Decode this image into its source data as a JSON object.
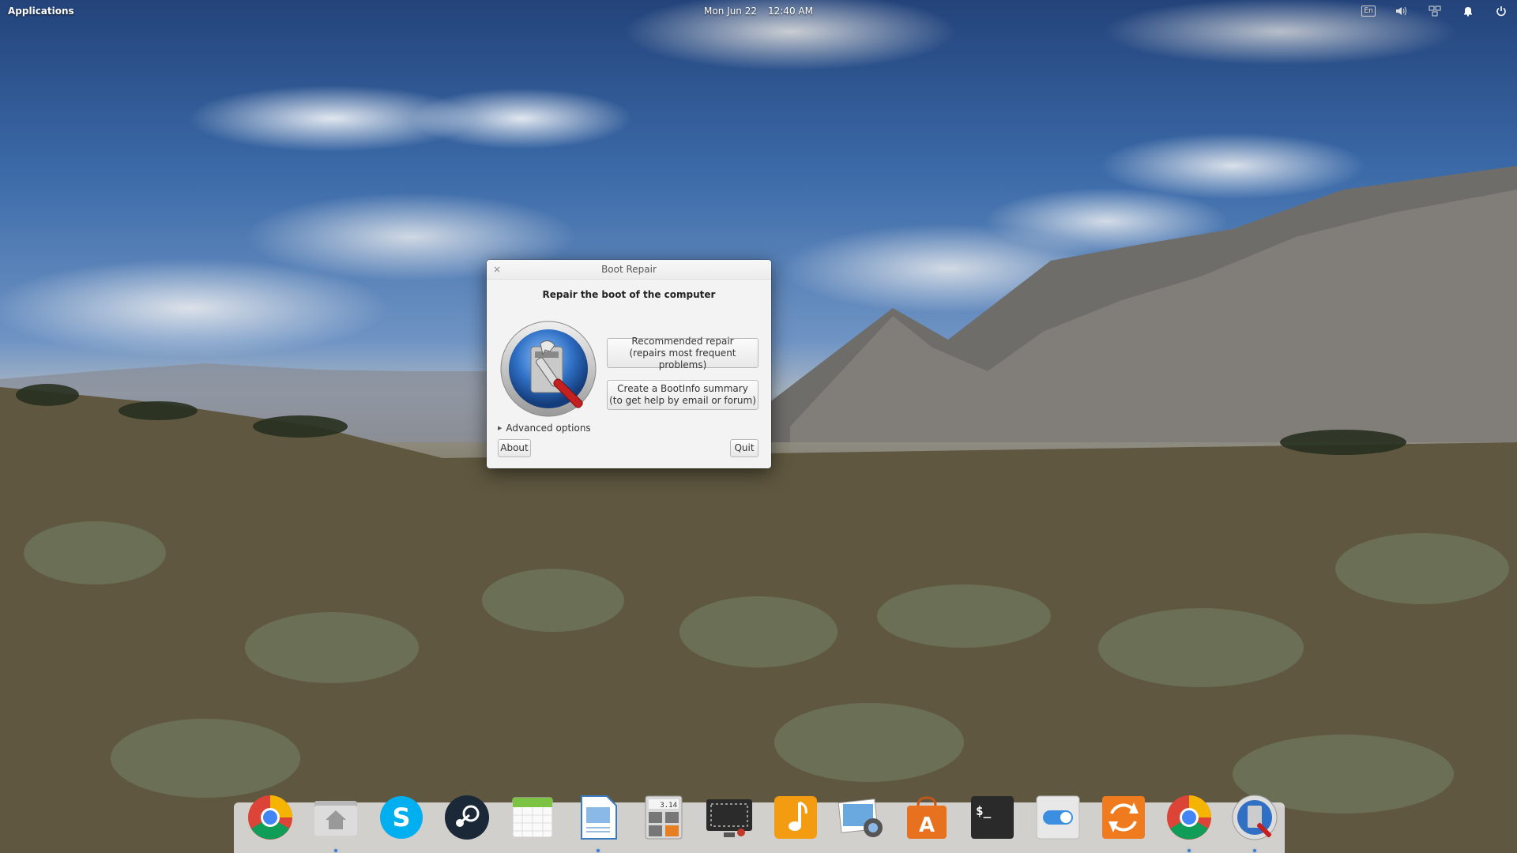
{
  "top_panel": {
    "applications_label": "Applications",
    "date": "Mon Jun 22",
    "time": "12:40 AM",
    "keyboard_layout": "En"
  },
  "dialog": {
    "title": "Boot Repair",
    "heading": "Repair the boot of the computer",
    "recommended_line1": "Recommended repair",
    "recommended_line2": "(repairs most frequent problems)",
    "bootinfo_line1": "Create a BootInfo summary",
    "bootinfo_line2": "(to get help by email or forum)",
    "advanced_label": "Advanced options",
    "about_label": "About",
    "quit_label": "Quit",
    "close_glyph": "×"
  },
  "dock": {
    "calc_display": "3.14",
    "terminal_prompt": "$_",
    "items": [
      {
        "name": "chrome-icon",
        "running": false
      },
      {
        "name": "files-icon",
        "running": true
      },
      {
        "name": "skype-icon",
        "running": false
      },
      {
        "name": "steam-icon",
        "running": false
      },
      {
        "name": "calendar-icon",
        "running": false
      },
      {
        "name": "document-viewer-icon",
        "running": true
      },
      {
        "name": "calculator-icon",
        "running": false
      },
      {
        "name": "screenshot-icon",
        "running": false
      },
      {
        "name": "music-icon",
        "running": false
      },
      {
        "name": "photos-icon",
        "running": false
      },
      {
        "name": "app-center-icon",
        "running": false
      },
      {
        "name": "terminal-icon",
        "running": false
      },
      {
        "name": "settings-toggle-icon",
        "running": false
      },
      {
        "name": "update-manager-icon",
        "running": false
      },
      {
        "name": "chrome-icon-2",
        "running": true
      },
      {
        "name": "boot-repair-icon",
        "running": true
      }
    ]
  }
}
